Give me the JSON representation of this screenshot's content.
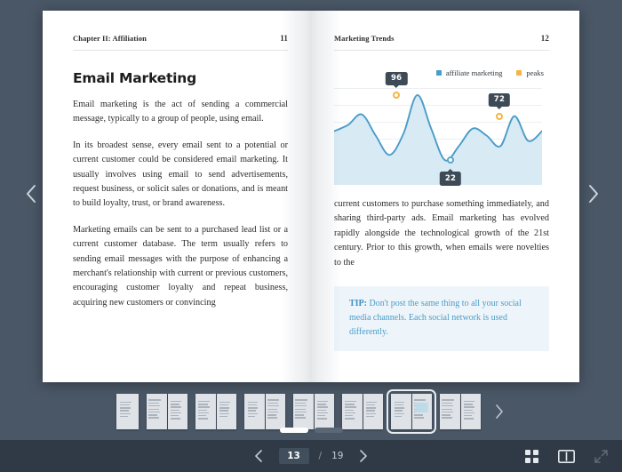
{
  "viewer": {
    "prev_spread_icon": "chevron-left-icon",
    "next_spread_icon": "chevron-right-icon"
  },
  "left_page": {
    "header": {
      "chapter": "Chapter II: Affiliation",
      "folio": "11"
    },
    "title": "Email Marketing",
    "paragraphs": [
      "Email marketing is the act of sending a commercial message, typically to a group of people, using email.",
      "In its broadest sense, every email sent to a potential or current customer could be considered email marketing. It usually involves using email to send advertisements, request business, or solicit sales or donations, and is meant to build loyalty, trust, or brand awareness.",
      "Marketing emails can be sent to a purchased lead list or a current customer database. The term usually refers to sending email messages with the purpose of enhancing a merchant's relationship with current or previous customers, encouraging customer loyalty and repeat business, acquiring new customers or convincing"
    ]
  },
  "right_page": {
    "header": {
      "chapter": "Marketing Trends",
      "folio": "12"
    },
    "paragraph": "current customers to purchase something immediately, and sharing third-party ads. Email marketing has evolved rapidly alongside the technological growth of the 21st century. Prior to this growth, when emails were novelties to the",
    "tip": {
      "lead": "TIP:",
      "text": " Don't post the same thing to all your social media channels. Each social network is used differently."
    }
  },
  "chart_data": {
    "type": "area",
    "title": "",
    "subtitle": "",
    "xlabel": "",
    "ylabel": "",
    "grid": true,
    "legend_position": "top-right",
    "ylim": [
      0,
      100
    ],
    "colors": {
      "line": "#4a9cc9",
      "fill": "#d8eaf4",
      "peak_marker": "#f5b544",
      "valley_marker": "#5aa7c8",
      "grid": "#eceff1"
    },
    "legend": [
      {
        "label": "affiliate marketing",
        "color": "#4a9cc9"
      },
      {
        "label": "peaks",
        "color": "#f5b544"
      }
    ],
    "series": [
      {
        "name": "affiliate marketing",
        "x": [
          0,
          5,
          12,
          20,
          27,
          34,
          42,
          50,
          57,
          64,
          71,
          78,
          85,
          92,
          100
        ],
        "values": [
          55,
          62,
          74,
          50,
          28,
          52,
          96,
          58,
          22,
          38,
          58,
          50,
          38,
          72,
          44,
          55
        ]
      }
    ],
    "annotations": [
      {
        "label": "96",
        "value": 96,
        "x_pct": 30.0,
        "kind": "peak",
        "position": "above"
      },
      {
        "label": "22",
        "value": 22,
        "x_pct": 56.0,
        "kind": "valley",
        "position": "below"
      },
      {
        "label": "72",
        "value": 72,
        "x_pct": 79.5,
        "kind": "peak",
        "position": "above"
      }
    ]
  },
  "thumbnails": {
    "next_icon": "chevron-right-icon",
    "items": [
      {
        "name": "thumb-1",
        "layout": "single",
        "selected": false
      },
      {
        "name": "thumb-2",
        "layout": "spread",
        "selected": false
      },
      {
        "name": "thumb-3",
        "layout": "spread",
        "selected": false
      },
      {
        "name": "thumb-4",
        "layout": "spread",
        "selected": false
      },
      {
        "name": "thumb-5",
        "layout": "spread",
        "selected": false
      },
      {
        "name": "thumb-6",
        "layout": "spread",
        "selected": false
      },
      {
        "name": "thumb-7",
        "layout": "spread",
        "selected": true
      },
      {
        "name": "thumb-8",
        "layout": "spread",
        "selected": false
      }
    ],
    "dots": [
      {
        "active": true
      },
      {
        "active": false
      }
    ]
  },
  "toolbar": {
    "prev_page_icon": "chevron-left-icon",
    "next_page_icon": "chevron-right-icon",
    "current_page": "13",
    "separator": "/",
    "total_pages": "19",
    "grid_view_icon": "grid-view-icon",
    "spread_view_icon": "book-spread-icon",
    "fullscreen_icon": "fullscreen-expand-icon"
  }
}
